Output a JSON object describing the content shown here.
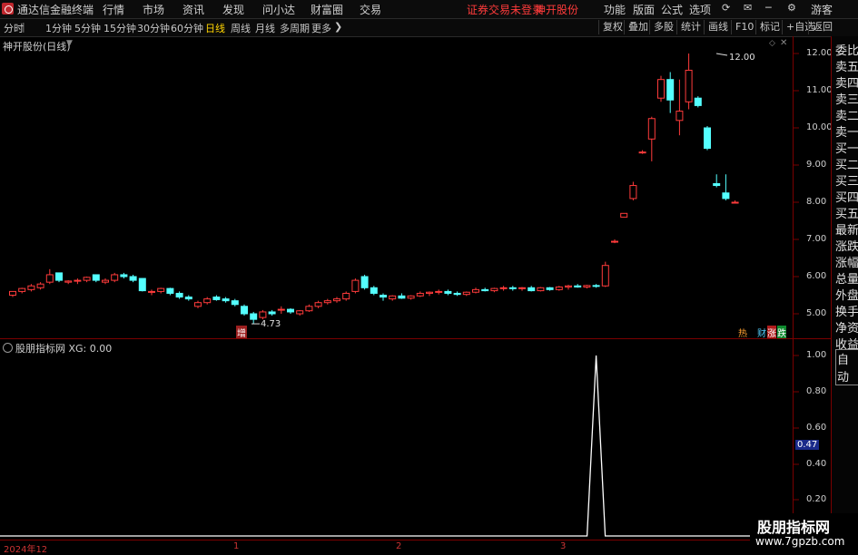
{
  "app": {
    "title": "通达信金融终端",
    "account_warning": "证券交易未登录",
    "stock_name": "神开股份",
    "user": "游客"
  },
  "menu": [
    "行情",
    "市场",
    "资讯",
    "发现",
    "问小达",
    "财富圈",
    "交易"
  ],
  "menu_right": [
    "功能",
    "版面",
    "公式",
    "选项"
  ],
  "periods": [
    "分时",
    "1分钟",
    "5分钟",
    "15分钟",
    "30分钟",
    "60分钟",
    "日线",
    "周线",
    "月线",
    "多周期",
    "更多"
  ],
  "active_period": "日线",
  "toolbar_right": [
    "复权",
    "叠加",
    "多股",
    "统计",
    "画线",
    "F10",
    "标记",
    "+自选",
    "返回"
  ],
  "main_chart": {
    "title": "神开股份(日线)",
    "y_ticks": [
      "12.00",
      "11.00",
      "10.00",
      "9.00",
      "8.00",
      "7.00",
      "6.00",
      "5.00"
    ],
    "high_label": "12.00",
    "low_label": "4.73",
    "markers": {
      "zeng": "增",
      "hot": "热",
      "cai": "财",
      "zhang": "涨",
      "die": "跌"
    }
  },
  "indicator": {
    "title": "股朋指标网 XG: 0.00",
    "y_ticks": [
      "1.00",
      "0.80",
      "0.60",
      "0.40",
      "0.20"
    ],
    "current_value": "0.47"
  },
  "x_axis": {
    "labels": [
      "2024年12",
      "1",
      "2",
      "3"
    ]
  },
  "right_panel": [
    "委比",
    "卖五",
    "卖四",
    "卖三",
    "卖二",
    "卖一",
    "买一",
    "买二",
    "买三",
    "买四",
    "买五",
    "最新",
    "涨跌",
    "涨幅",
    "总量",
    "外盘",
    "换手",
    "净资",
    "收益",
    "自动"
  ],
  "watermark": {
    "line1": "股朋指标网",
    "line2": "www.7gpzb.com"
  },
  "colors": {
    "up": "#ff3b3b",
    "down": "#54ffff",
    "axis": "#7a0000",
    "active": "#ffd400"
  },
  "chart_data": {
    "type": "candlestick",
    "candles": [
      [
        5.5,
        5.6,
        5.45,
        5.6
      ],
      [
        5.6,
        5.7,
        5.55,
        5.68
      ],
      [
        5.65,
        5.8,
        5.6,
        5.75
      ],
      [
        5.7,
        5.85,
        5.65,
        5.8
      ],
      [
        5.85,
        6.2,
        5.8,
        6.05
      ],
      [
        6.1,
        6.1,
        5.85,
        5.9
      ],
      [
        5.85,
        5.9,
        5.8,
        5.88
      ],
      [
        5.88,
        5.95,
        5.8,
        5.9
      ],
      [
        5.9,
        6.0,
        5.85,
        5.98
      ],
      [
        6.05,
        6.05,
        5.85,
        5.9
      ],
      [
        5.85,
        5.95,
        5.8,
        5.9
      ],
      [
        5.9,
        6.1,
        5.85,
        6.05
      ],
      [
        6.05,
        6.1,
        5.95,
        6.0
      ],
      [
        6.0,
        6.05,
        5.85,
        5.9
      ],
      [
        5.95,
        5.95,
        5.6,
        5.62
      ],
      [
        5.6,
        5.65,
        5.5,
        5.6
      ],
      [
        5.6,
        5.7,
        5.55,
        5.68
      ],
      [
        5.68,
        5.7,
        5.5,
        5.55
      ],
      [
        5.55,
        5.6,
        5.4,
        5.45
      ],
      [
        5.45,
        5.5,
        5.35,
        5.4
      ],
      [
        5.2,
        5.35,
        5.15,
        5.3
      ],
      [
        5.3,
        5.45,
        5.25,
        5.4
      ],
      [
        5.45,
        5.5,
        5.35,
        5.38
      ],
      [
        5.4,
        5.45,
        5.3,
        5.35
      ],
      [
        5.35,
        5.4,
        5.2,
        5.25
      ],
      [
        5.2,
        5.25,
        4.95,
        5.0
      ],
      [
        5.0,
        5.05,
        4.73,
        4.85
      ],
      [
        4.9,
        5.1,
        4.85,
        5.05
      ],
      [
        5.05,
        5.1,
        4.95,
        5.0
      ],
      [
        5.1,
        5.2,
        5.0,
        5.12
      ],
      [
        5.12,
        5.15,
        5.0,
        5.05
      ],
      [
        5.0,
        5.1,
        4.95,
        5.08
      ],
      [
        5.08,
        5.25,
        5.05,
        5.2
      ],
      [
        5.2,
        5.35,
        5.15,
        5.3
      ],
      [
        5.3,
        5.4,
        5.25,
        5.35
      ],
      [
        5.35,
        5.45,
        5.3,
        5.4
      ],
      [
        5.4,
        5.6,
        5.35,
        5.55
      ],
      [
        5.6,
        5.95,
        5.55,
        5.9
      ],
      [
        6.0,
        6.05,
        5.65,
        5.7
      ],
      [
        5.7,
        5.75,
        5.5,
        5.55
      ],
      [
        5.5,
        5.55,
        5.35,
        5.45
      ],
      [
        5.4,
        5.5,
        5.35,
        5.48
      ],
      [
        5.48,
        5.55,
        5.4,
        5.42
      ],
      [
        5.42,
        5.5,
        5.38,
        5.48
      ],
      [
        5.48,
        5.6,
        5.45,
        5.55
      ],
      [
        5.55,
        5.6,
        5.48,
        5.58
      ],
      [
        5.58,
        5.65,
        5.52,
        5.6
      ],
      [
        5.6,
        5.65,
        5.5,
        5.55
      ],
      [
        5.55,
        5.6,
        5.48,
        5.52
      ],
      [
        5.52,
        5.6,
        5.48,
        5.58
      ],
      [
        5.58,
        5.7,
        5.55,
        5.65
      ],
      [
        5.65,
        5.7,
        5.6,
        5.62
      ],
      [
        5.62,
        5.7,
        5.58,
        5.68
      ],
      [
        5.68,
        5.75,
        5.62,
        5.7
      ],
      [
        5.7,
        5.75,
        5.62,
        5.68
      ],
      [
        5.68,
        5.72,
        5.62,
        5.7
      ],
      [
        5.7,
        5.75,
        5.6,
        5.62
      ],
      [
        5.62,
        5.72,
        5.6,
        5.7
      ],
      [
        5.7,
        5.72,
        5.62,
        5.65
      ],
      [
        5.65,
        5.75,
        5.62,
        5.72
      ],
      [
        5.72,
        5.78,
        5.65,
        5.75
      ],
      [
        5.75,
        5.8,
        5.7,
        5.72
      ],
      [
        5.72,
        5.78,
        5.68,
        5.76
      ],
      [
        5.76,
        5.8,
        5.7,
        5.75
      ],
      [
        5.75,
        6.4,
        5.72,
        6.3
      ],
      [
        6.95,
        7.0,
        6.9,
        6.95
      ],
      [
        7.6,
        7.7,
        7.6,
        7.7
      ],
      [
        8.1,
        8.55,
        8.05,
        8.45
      ],
      [
        9.35,
        9.4,
        9.3,
        9.35
      ],
      [
        9.7,
        10.3,
        9.1,
        10.25
      ],
      [
        10.8,
        11.4,
        10.7,
        11.3
      ],
      [
        11.3,
        11.5,
        10.4,
        10.75
      ],
      [
        10.2,
        11.3,
        9.8,
        10.45
      ],
      [
        10.7,
        12.0,
        10.5,
        11.55
      ],
      [
        10.8,
        10.85,
        10.55,
        10.6
      ],
      [
        10.0,
        10.05,
        9.4,
        9.45
      ],
      [
        8.5,
        8.75,
        8.4,
        8.45
      ],
      [
        8.25,
        8.75,
        8.05,
        8.1
      ],
      [
        8.0,
        8.05,
        7.98,
        8.0
      ]
    ],
    "indicator_series": [
      0,
      0,
      0,
      0,
      0,
      0,
      0,
      0,
      0,
      0,
      0,
      0,
      0,
      0,
      0,
      0,
      0,
      0,
      0,
      0,
      0,
      0,
      0,
      0,
      0,
      0,
      0,
      0,
      0,
      0,
      0,
      0,
      0,
      0,
      0,
      0,
      0,
      0,
      0,
      0,
      0,
      0,
      0,
      0,
      0,
      0,
      0,
      0,
      0,
      0,
      0,
      0,
      0,
      0,
      0,
      0,
      0,
      0,
      0,
      0,
      0,
      0,
      0,
      1,
      0,
      0,
      0,
      0,
      0,
      0,
      0,
      0,
      0,
      0,
      0,
      0,
      0,
      0,
      0
    ],
    "ylim_main": [
      4.6,
      12.4
    ],
    "ylim_indicator": [
      0,
      1.0
    ]
  }
}
